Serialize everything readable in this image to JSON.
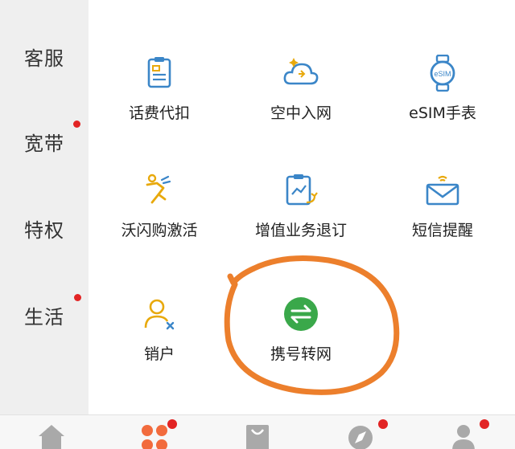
{
  "sidebar": {
    "items": [
      {
        "label": "客服",
        "badge": false
      },
      {
        "label": "宽带",
        "badge": true
      },
      {
        "label": "特权",
        "badge": false
      },
      {
        "label": "生活",
        "badge": true
      }
    ]
  },
  "services": [
    {
      "label": "话费代扣",
      "icon": "bill-clipboard-icon"
    },
    {
      "label": "空中入网",
      "icon": "cloud-sparkle-icon"
    },
    {
      "label": "eSIM手表",
      "icon": "esim-watch-icon"
    },
    {
      "label": "沃闪购激活",
      "icon": "running-person-icon"
    },
    {
      "label": "增值业务退订",
      "icon": "unsubscribe-chart-icon"
    },
    {
      "label": "短信提醒",
      "icon": "sms-envelope-icon"
    },
    {
      "label": "销户",
      "icon": "cancel-account-icon"
    },
    {
      "label": "携号转网",
      "icon": "swap-arrows-icon"
    }
  ],
  "annotation": {
    "highlighted": "携号转网"
  },
  "tabbar": {
    "tabs": [
      {
        "icon": "home-icon",
        "badge": false
      },
      {
        "icon": "apps-grid-icon",
        "badge": true,
        "active": true
      },
      {
        "icon": "shopping-bag-icon",
        "badge": false
      },
      {
        "icon": "compass-icon",
        "badge": true
      },
      {
        "icon": "user-icon",
        "badge": true
      }
    ]
  },
  "colors": {
    "sidebar_bg": "#efefef",
    "icon_blue": "#3b86c8",
    "icon_yellow": "#e8a90c",
    "icon_green": "#3aa84a",
    "accent_red": "#e22424",
    "circle_orange": "#ec7f2c",
    "tab_gray": "#a9a9a9",
    "tab_active": "#f26b3d"
  }
}
